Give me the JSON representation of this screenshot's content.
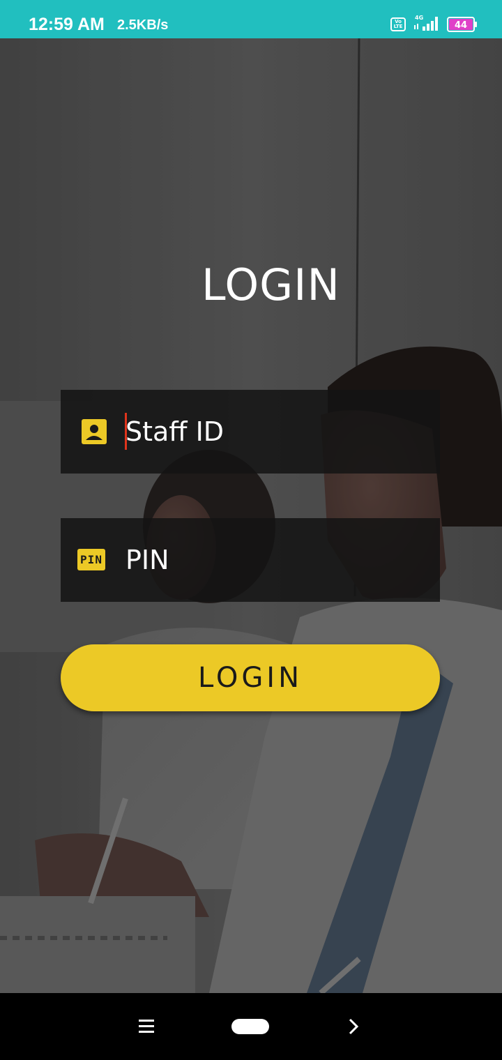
{
  "status_bar": {
    "time": "12:59 AM",
    "network_speed": "2.5KB/s",
    "volte_label": "Vo LTE",
    "network_type": "4G",
    "battery_level": "44",
    "icons": [
      "volte-icon",
      "signal-icon",
      "battery-icon"
    ]
  },
  "login": {
    "title": "LOGIN",
    "staff_id": {
      "placeholder": "Staff ID",
      "value": "",
      "icon": "person-badge-icon"
    },
    "pin": {
      "placeholder": "PIN",
      "value": "",
      "icon_label": "PIN",
      "icon": "pin-icon"
    },
    "button_label": "LOGIN"
  },
  "navigation_bar": {
    "icons": [
      "menu-icon",
      "home-pill-icon",
      "back-chevron-icon"
    ]
  },
  "colors": {
    "status_bar": "#21bfbf",
    "accent_yellow": "#ecc926",
    "field_background": "#141414",
    "caret": "#e0341c",
    "battery_fill": "#e040c8"
  }
}
